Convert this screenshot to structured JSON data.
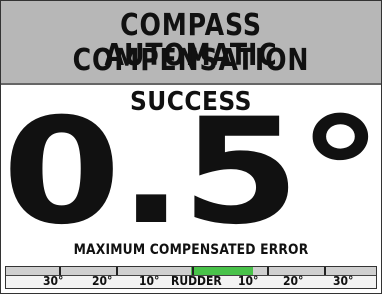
{
  "header": {
    "line1": "COMPASS AUTOMATIC",
    "line2": "COMPENSATION"
  },
  "result": {
    "status": "SUCCESS",
    "value": "0.5°",
    "caption": "MAXIMUM COMPENSATED ERROR"
  },
  "rudder": {
    "labels": {
      "left30": "30°",
      "left20": "20°",
      "left10": "10°",
      "center": "RUDDER",
      "right10": "10°",
      "right20": "20°",
      "right30": "30°"
    },
    "fill_range_degrees": [
      0,
      10
    ],
    "colors": {
      "fill": "#49c24a"
    }
  },
  "colors": {
    "header_bg": "#b7b7b7",
    "background": "#ffffff",
    "text": "#111111"
  }
}
